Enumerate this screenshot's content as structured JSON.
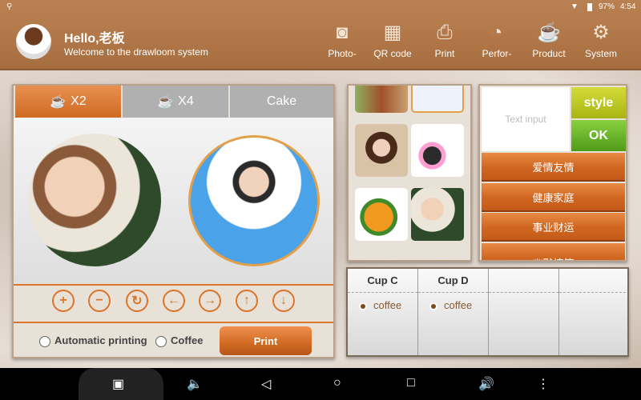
{
  "status": {
    "battery": "97%",
    "time": "4:54"
  },
  "header": {
    "greeting": "Hello,老板",
    "welcome": "Welcome to the drawloom system",
    "nav": [
      {
        "label": "Photo-",
        "icon": "camera-icon"
      },
      {
        "label": "QR code",
        "icon": "qr-icon"
      },
      {
        "label": "Print",
        "icon": "printer-icon"
      },
      {
        "label": "Perfor-",
        "icon": "pie-chart-icon"
      },
      {
        "label": "Product",
        "icon": "cup-icon"
      },
      {
        "label": "System",
        "icon": "gear-icon"
      }
    ]
  },
  "left": {
    "tabs": [
      {
        "label": "X2"
      },
      {
        "label": "X4"
      },
      {
        "label": "Cake"
      }
    ],
    "auto_print": "Automatic printing",
    "coffee": "Coffee",
    "print": "Print"
  },
  "text_panel": {
    "placeholder": "Text input",
    "style": "style",
    "ok": "OK",
    "categories": [
      "爱情友情",
      "健康家庭",
      "事业财运",
      "幽默搞笑"
    ]
  },
  "cups": [
    {
      "name": "Cup C",
      "option": "coffee"
    },
    {
      "name": "Cup D",
      "option": "coffee"
    },
    {
      "name": "",
      "option": ""
    },
    {
      "name": "",
      "option": ""
    }
  ],
  "colors": {
    "accent": "#d9742a",
    "header": "#b07647",
    "style_btn": "#b8c41a",
    "ok_btn": "#5aa81e"
  }
}
